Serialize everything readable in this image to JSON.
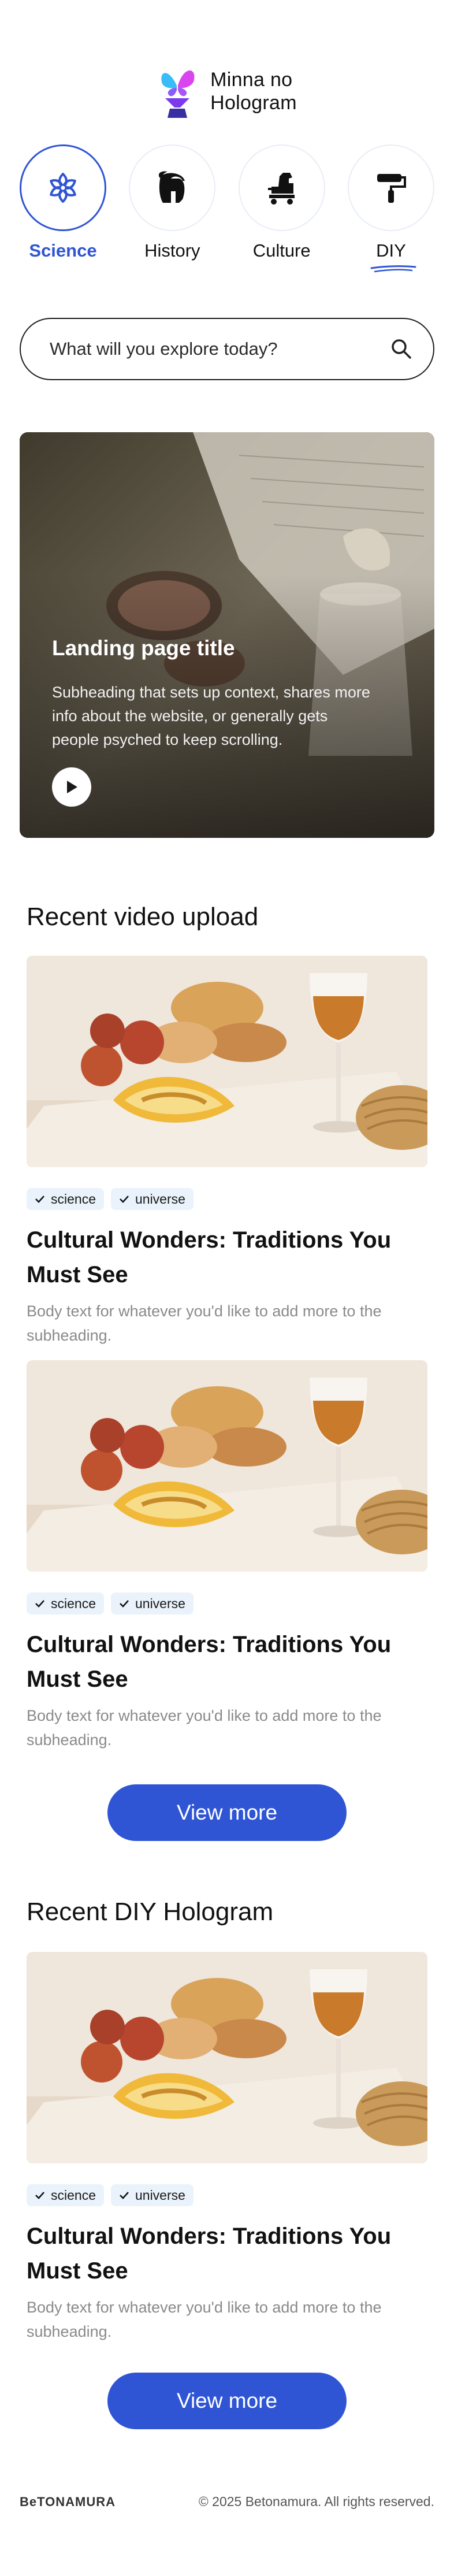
{
  "brand": {
    "name_line1": "Minna no",
    "name_line2": "Hologram",
    "logo_icon": "butterfly-vase-logo",
    "colors": {
      "purple": "#8b5cf6",
      "magenta": "#d946ef",
      "cyan": "#38bdf8",
      "navy": "#3730a3"
    }
  },
  "categories": [
    {
      "label": "Science",
      "icon": "atom-flower-icon",
      "active": true
    },
    {
      "label": "History",
      "icon": "spartan-helmet-icon",
      "active": false
    },
    {
      "label": "Culture",
      "icon": "trojan-horse-icon",
      "active": false
    },
    {
      "label": "DIY",
      "icon": "paint-roller-icon",
      "active": false
    }
  ],
  "search": {
    "placeholder": "What will you explore today?",
    "icon": "search-icon"
  },
  "hero": {
    "title": "Landing page title",
    "subtitle": "Subheading that sets up context, shares more info about the website, or generally gets people psyched to keep scrolling.",
    "play_icon": "play-icon"
  },
  "recent_video": {
    "title": "Recent video upload",
    "cards": [
      {
        "tags": [
          "science",
          "universe"
        ],
        "title": "Cultural Wonders: Traditions You Must See",
        "body": "Body text for whatever you'd like to add more to the subheading."
      },
      {
        "tags": [
          "science",
          "universe"
        ],
        "title": "Cultural Wonders: Traditions You Must See",
        "body": "Body text for whatever you'd like to add more to the subheading."
      }
    ],
    "view_more": "View more"
  },
  "recent_diy": {
    "title": "Recent DIY Hologram",
    "cards": [
      {
        "tags": [
          "science",
          "universe"
        ],
        "title": "Cultural Wonders: Traditions You Must See",
        "body": "Body text for whatever you'd like to add more to the subheading."
      }
    ],
    "view_more": "View more"
  },
  "footer": {
    "logo": "BeTONAMURA",
    "copyright": "© 2025 Betonamura. All rights reserved."
  },
  "accent_color": "#2f55d4"
}
